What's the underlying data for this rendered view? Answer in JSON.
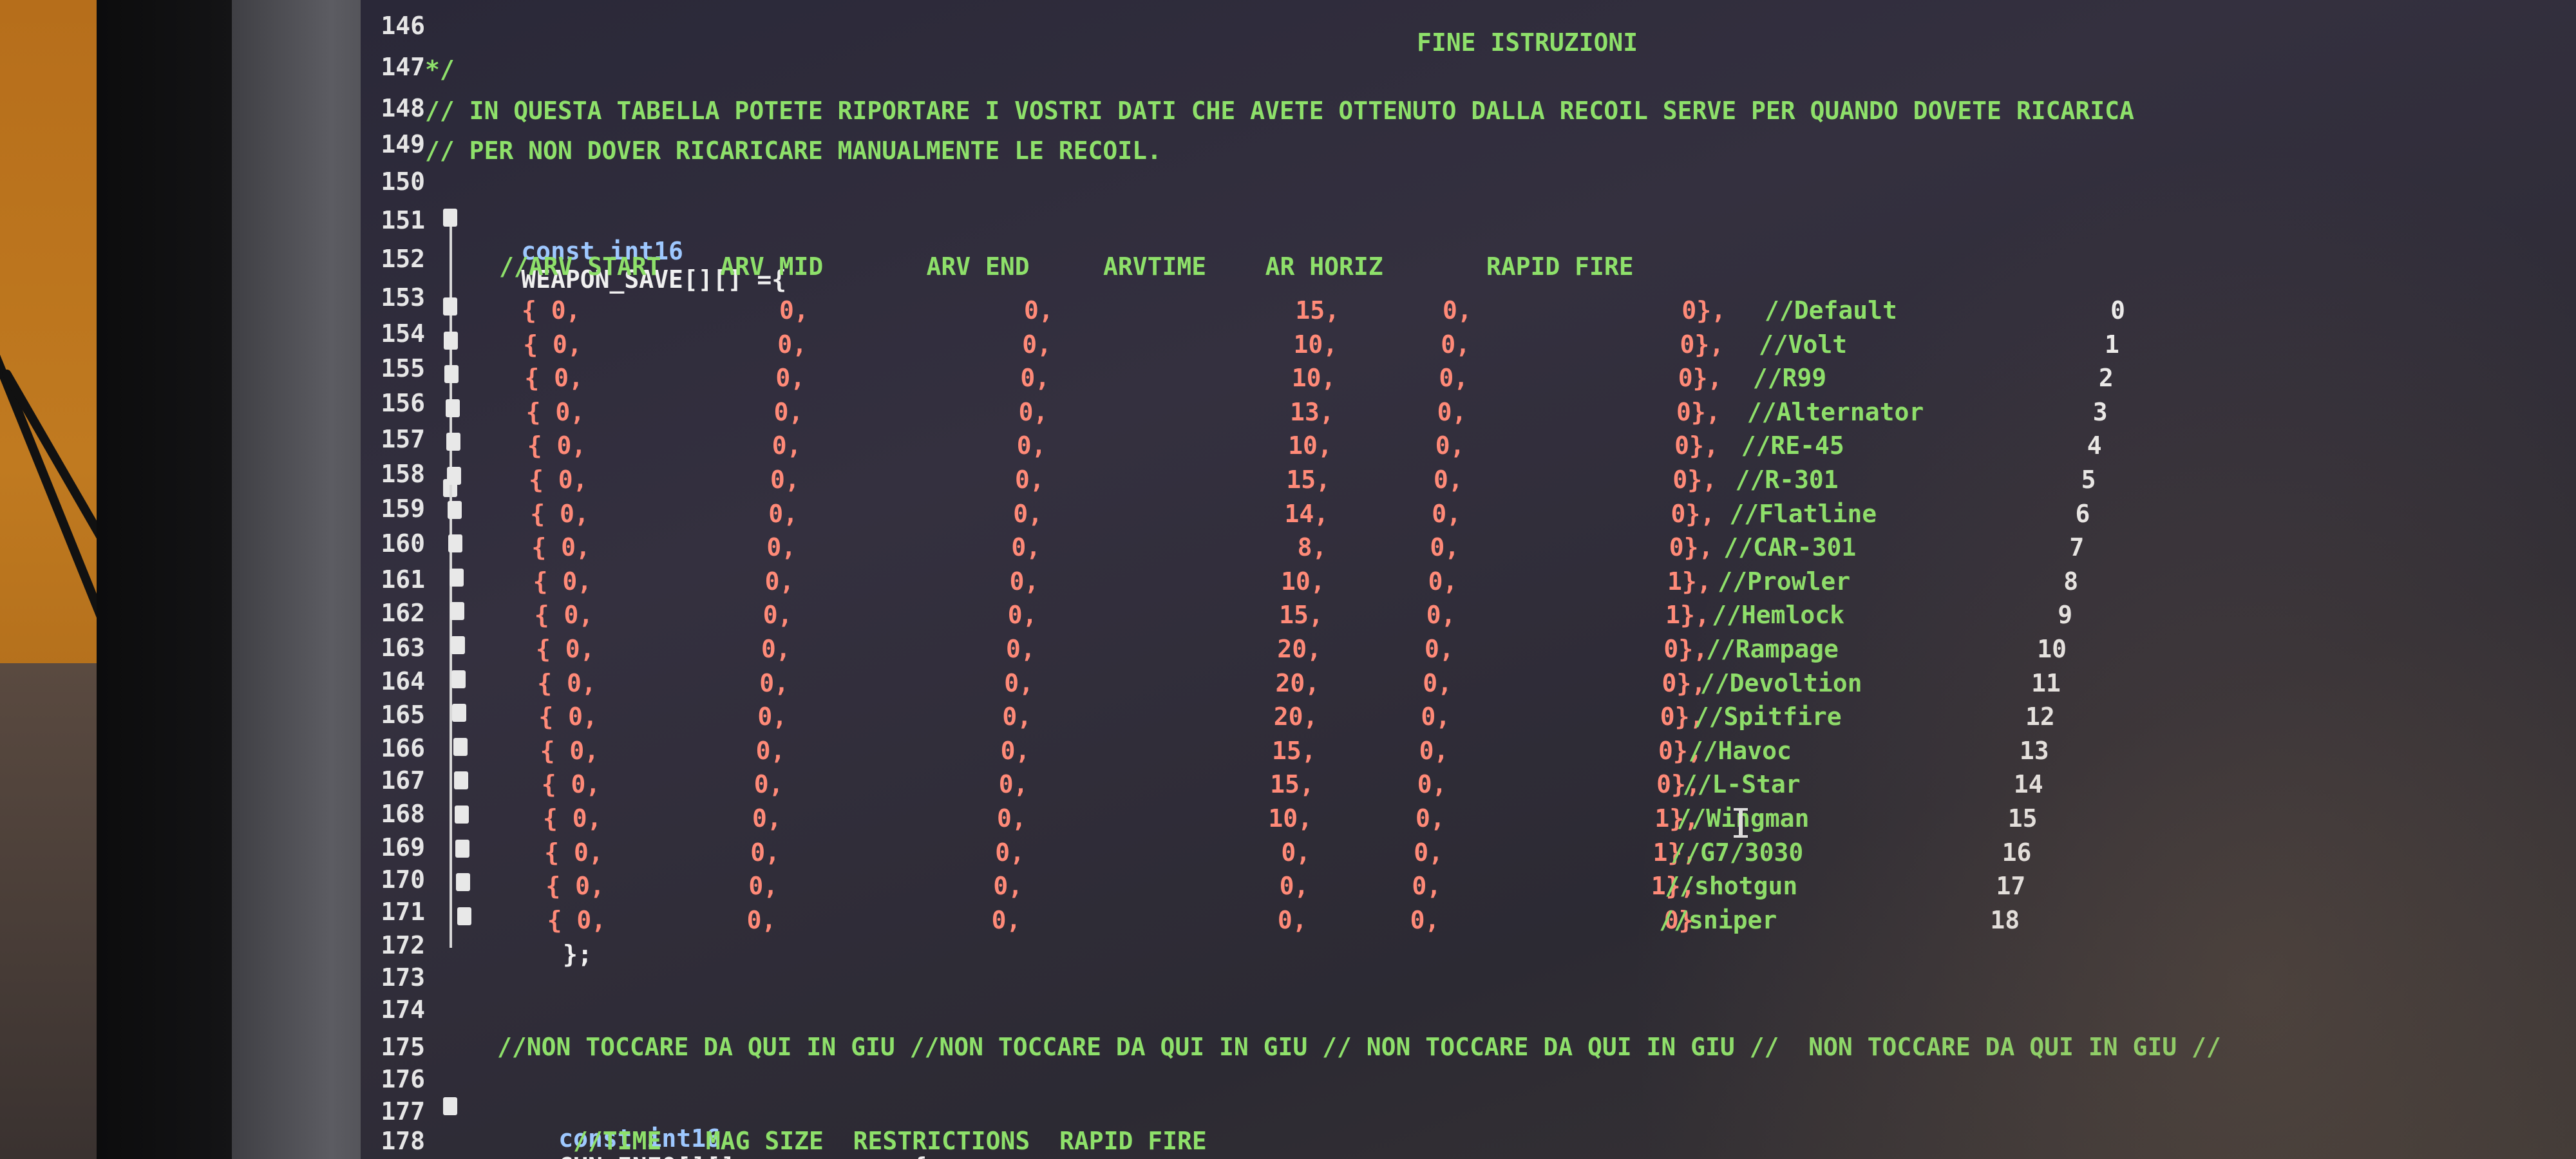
{
  "editor": {
    "line_numbers": [
      "146",
      "147",
      "148",
      "149",
      "150",
      "151",
      "152",
      "153",
      "154",
      "155",
      "156",
      "157",
      "158",
      "159",
      "160",
      "161",
      "162",
      "163",
      "164",
      "165",
      "166",
      "167",
      "168",
      "169",
      "170",
      "171",
      "172",
      "173",
      "174",
      "175",
      "176",
      "177",
      "178"
    ],
    "line_146": "FINE ISTRUZIONI",
    "line_147": "*/",
    "line_148": "// IN QUESTA TABELLA POTETE RIPORTARE I VOSTRI DATI CHE AVETE OTTENUTO DALLA RECOIL SERVE PER QUANDO DOVETE RICARICA",
    "line_149": "// PER NON DOVER RICARICARE MANUALMENTE LE RECOIL.",
    "line_151_keyword": "const int16",
    "line_151_name": "WEAPON_SAVE[][] ={",
    "line_152": "//ARV START    ARV MID       ARV END     ARVTIME    AR HORIZ       RAPID FIRE",
    "weapon_rows": [
      {
        "c1": "{ 0,",
        "c2": "0,",
        "c3": "0,",
        "c4": "15,",
        "c5": "0,",
        "c6": "0},",
        "comment": "//Default",
        "idx": "0"
      },
      {
        "c1": "{ 0,",
        "c2": "0,",
        "c3": "0,",
        "c4": "10,",
        "c5": "0,",
        "c6": "0},",
        "comment": "//Volt",
        "idx": "1"
      },
      {
        "c1": "{ 0,",
        "c2": "0,",
        "c3": "0,",
        "c4": "10,",
        "c5": "0,",
        "c6": "0},",
        "comment": "//R99",
        "idx": "2"
      },
      {
        "c1": "{ 0,",
        "c2": "0,",
        "c3": "0,",
        "c4": "13,",
        "c5": "0,",
        "c6": "0},",
        "comment": "//Alternator",
        "idx": "3"
      },
      {
        "c1": "{ 0,",
        "c2": "0,",
        "c3": "0,",
        "c4": "10,",
        "c5": "0,",
        "c6": "0},",
        "comment": "//RE-45",
        "idx": "4"
      },
      {
        "c1": "{ 0,",
        "c2": "0,",
        "c3": "0,",
        "c4": "15,",
        "c5": "0,",
        "c6": "0},",
        "comment": "//R-301",
        "idx": "5"
      },
      {
        "c1": "{ 0,",
        "c2": "0,",
        "c3": "0,",
        "c4": "14,",
        "c5": "0,",
        "c6": "0},",
        "comment": "//Flatline",
        "idx": "6"
      },
      {
        "c1": "{ 0,",
        "c2": "0,",
        "c3": "0,",
        "c4": "8,",
        "c5": "0,",
        "c6": "0},",
        "comment": "//CAR-301",
        "idx": "7"
      },
      {
        "c1": "{ 0,",
        "c2": "0,",
        "c3": "0,",
        "c4": "10,",
        "c5": "0,",
        "c6": "1},",
        "comment": "//Prowler",
        "idx": "8"
      },
      {
        "c1": "{ 0,",
        "c2": "0,",
        "c3": "0,",
        "c4": "15,",
        "c5": "0,",
        "c6": "1},",
        "comment": "//Hemlock",
        "idx": "9"
      },
      {
        "c1": "{ 0,",
        "c2": "0,",
        "c3": "0,",
        "c4": "20,",
        "c5": "0,",
        "c6": "0},",
        "comment": "//Rampage",
        "idx": "10"
      },
      {
        "c1": "{ 0,",
        "c2": "0,",
        "c3": "0,",
        "c4": "20,",
        "c5": "0,",
        "c6": "0},",
        "comment": "//Devoltion",
        "idx": "11"
      },
      {
        "c1": "{ 0,",
        "c2": "0,",
        "c3": "0,",
        "c4": "20,",
        "c5": "0,",
        "c6": "0},",
        "comment": "//Spitfire",
        "idx": "12"
      },
      {
        "c1": "{ 0,",
        "c2": "0,",
        "c3": "0,",
        "c4": "15,",
        "c5": "0,",
        "c6": "0},",
        "comment": "//Havoc",
        "idx": "13"
      },
      {
        "c1": "{ 0,",
        "c2": "0,",
        "c3": "0,",
        "c4": "15,",
        "c5": "0,",
        "c6": "0},",
        "comment": "//L-Star",
        "idx": "14"
      },
      {
        "c1": "{ 0,",
        "c2": "0,",
        "c3": "0,",
        "c4": "10,",
        "c5": "0,",
        "c6": "1},",
        "comment": "//Wingman",
        "idx": "15"
      },
      {
        "c1": "{ 0,",
        "c2": "0,",
        "c3": "0,",
        "c4": "0,",
        "c5": "0,",
        "c6": "1},",
        "comment": "//G7/3030",
        "idx": "16"
      },
      {
        "c1": "{ 0,",
        "c2": "0,",
        "c3": "0,",
        "c4": "0,",
        "c5": "0,",
        "c6": "1},",
        "comment": "//shotgun",
        "idx": "17"
      },
      {
        "c1": "{ 0,",
        "c2": "0,",
        "c3": "0,",
        "c4": "0,",
        "c5": "0,",
        "c6": "0}",
        "comment": "//sniper",
        "idx": "18"
      }
    ],
    "line_172": "};",
    "line_175": "//NON TOCCARE DA QUI IN GIU //NON TOCCARE DA QUI IN GIU // NON TOCCARE DA QUI IN GIU //  NON TOCCARE DA QUI IN GIU //",
    "line_177_keyword": "const int16",
    "line_177_name": "GUN_INFO[][]          = {",
    "line_178": "//TIME   MAG SIZE  RESTRICTIONS  RAPID FIRE"
  },
  "colors": {
    "comment": "#8ee06a",
    "number": "#ff8a78",
    "keyword": "#9ec8ff",
    "text": "#f0f0f0"
  }
}
